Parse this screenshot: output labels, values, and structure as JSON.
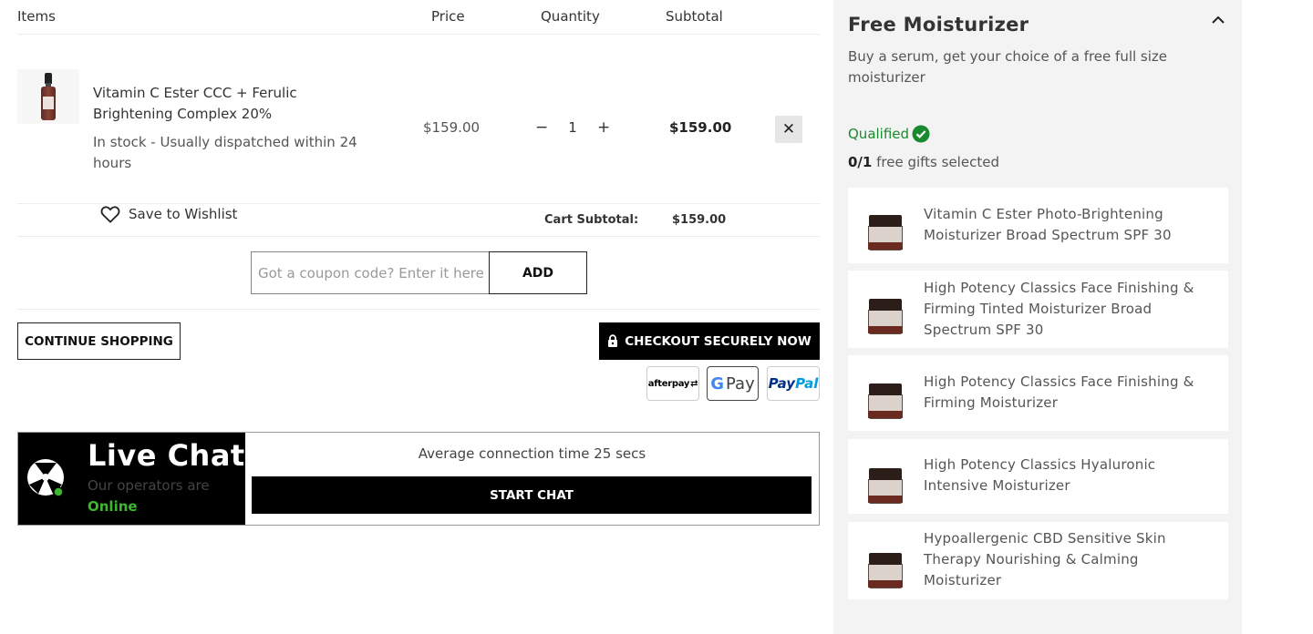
{
  "cart": {
    "headers": {
      "items": "Items",
      "price": "Price",
      "quantity": "Quantity",
      "subtotal": "Subtotal"
    },
    "item": {
      "name": "Vitamin C Ester CCC + Ferulic Brightening Complex 20%",
      "stock": "In stock  -  Usually dispatched within 24 hours",
      "price": "$159.00",
      "quantity": "1",
      "qty_minus": "−",
      "qty_plus": "+",
      "subtotal": "$159.00",
      "remove": "✕",
      "wishlist": "Save to Wishlist"
    },
    "cart_subtotal_label": "Cart Subtotal:",
    "cart_subtotal_value": "$159.00",
    "coupon": {
      "placeholder": "Got a coupon code? Enter it here",
      "button": "ADD"
    },
    "continue_shopping": "CONTINUE SHOPPING",
    "checkout": "CHECKOUT SECURELY NOW",
    "payment_methods": {
      "afterpay": "afterpay",
      "gpay_g": "G",
      "gpay_label": "Pay",
      "paypal_1": "Pay",
      "paypal_2": "Pal"
    }
  },
  "livechat": {
    "title": "Live Chat",
    "subtitle": "Our operators are",
    "status": "Online",
    "average": "Average connection time 25 secs",
    "start": "START CHAT"
  },
  "promo": {
    "title": "Free Moisturizer",
    "description": "Buy a serum, get your choice of a free full size moisturizer",
    "qualified": "Qualified",
    "gift_count_selected": "0/1",
    "gift_count_text": " free gifts selected",
    "gifts": [
      {
        "name": "Vitamin C Ester Photo-Brightening Moisturizer Broad Spectrum SPF 30"
      },
      {
        "name": "High Potency Classics Face Finishing & Firming Tinted Moisturizer Broad Spectrum SPF 30"
      },
      {
        "name": "High Potency Classics Face Finishing & Firming Moisturizer"
      },
      {
        "name": "High Potency Classics Hyaluronic Intensive Moisturizer"
      },
      {
        "name": "Hypoallergenic CBD Sensitive Skin Therapy Nourishing & Calming Moisturizer"
      }
    ]
  },
  "colors": {
    "qualified_green": "#1a8a2e",
    "online_green": "#3db82e",
    "panel_bg": "#f3f3f3",
    "button_black": "#000000"
  },
  "icons": [
    "heart-outline-icon",
    "lock-icon",
    "close-icon",
    "chevron-up-icon",
    "check-circle-icon",
    "live-chat-logo-icon"
  ]
}
